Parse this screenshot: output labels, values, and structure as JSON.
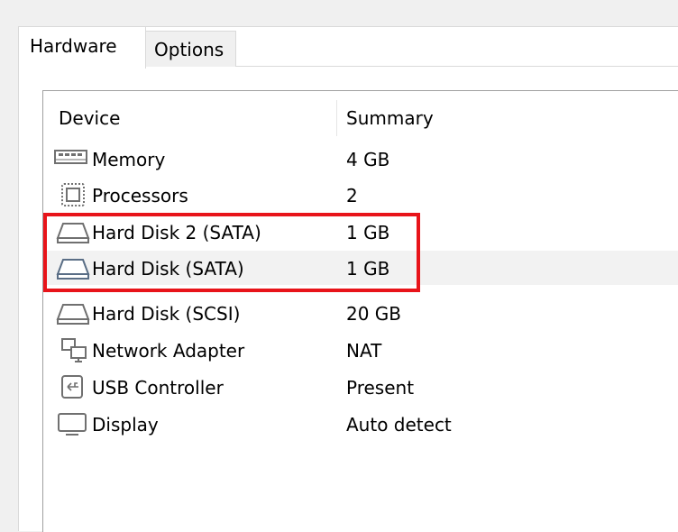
{
  "tabs": [
    {
      "label": "Hardware",
      "active": true
    },
    {
      "label": "Options",
      "active": false
    }
  ],
  "columns": {
    "device": "Device",
    "summary": "Summary"
  },
  "devices": [
    {
      "device": "Memory",
      "summary": "4 GB",
      "icon": "memory-icon"
    },
    {
      "device": "Processors",
      "summary": "2",
      "icon": "processor-icon"
    },
    {
      "device": "Hard Disk 2 (SATA)",
      "summary": "1 GB",
      "icon": "hard-disk-icon"
    },
    {
      "device": "Hard Disk (SATA)",
      "summary": "1 GB",
      "icon": "hard-disk-icon",
      "selected": true
    },
    {
      "device": "Hard Disk (SCSI)",
      "summary": "20 GB",
      "icon": "hard-disk-icon"
    },
    {
      "device": "Network Adapter",
      "summary": "NAT",
      "icon": "network-adapter-icon"
    },
    {
      "device": "USB Controller",
      "summary": "Present",
      "icon": "usb-icon"
    },
    {
      "device": "Display",
      "summary": "Auto detect",
      "icon": "display-icon"
    }
  ],
  "colors": {
    "highlight": "#e8141a",
    "selected_row": "#f2f2f2"
  }
}
